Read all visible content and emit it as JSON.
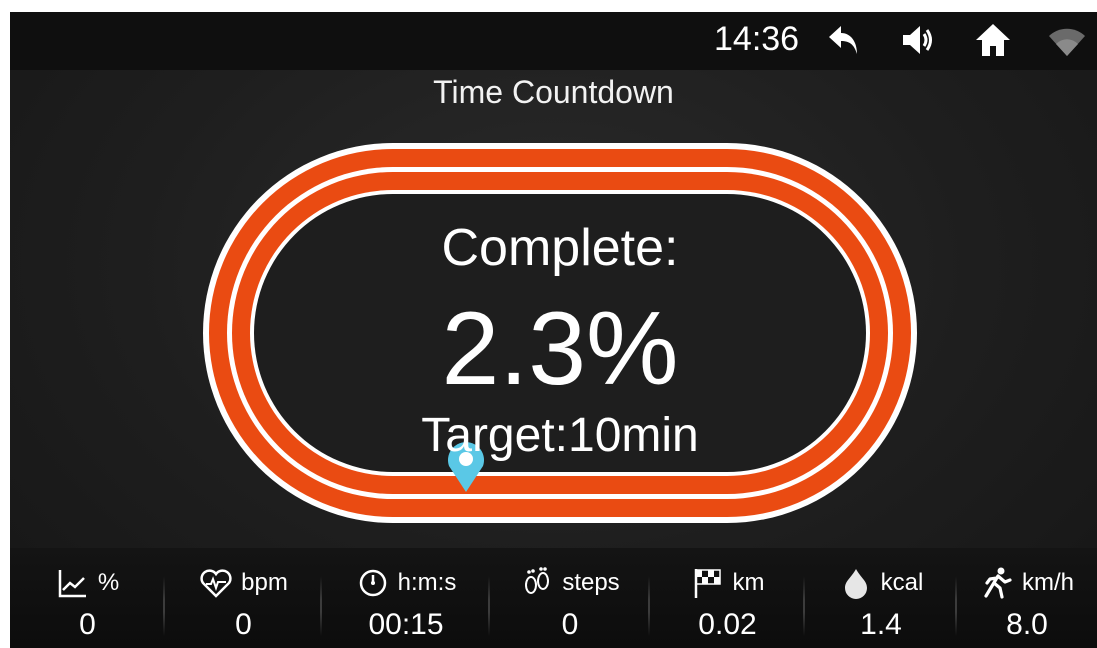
{
  "status_bar": {
    "time": "14:36"
  },
  "title": "Time Countdown",
  "progress": {
    "complete_label": "Complete:",
    "complete_value": "2.3%",
    "target_label": "Target:10min",
    "fraction": 0.023
  },
  "colors": {
    "track": "#ea4b12",
    "marker": "#5ac8e6",
    "background": "#1e1e1e"
  },
  "metrics": [
    {
      "icon": "incline-chart-icon",
      "unit": "%",
      "value": "0"
    },
    {
      "icon": "heart-rate-icon",
      "unit": "bpm",
      "value": "0"
    },
    {
      "icon": "stopwatch-icon",
      "unit": "h:m:s",
      "value": "00:15"
    },
    {
      "icon": "footprints-icon",
      "unit": "steps",
      "value": "0"
    },
    {
      "icon": "checkered-flag-icon",
      "unit": "km",
      "value": "0.02"
    },
    {
      "icon": "flame-icon",
      "unit": "kcal",
      "value": "1.4"
    },
    {
      "icon": "runner-icon",
      "unit": "km/h",
      "value": "8.0"
    }
  ]
}
